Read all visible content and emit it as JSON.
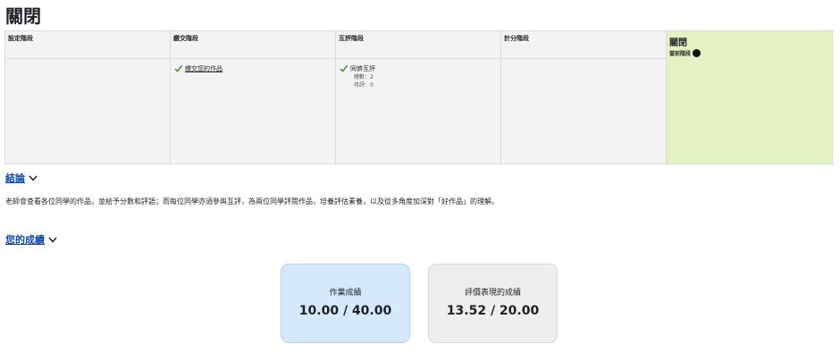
{
  "page": {
    "title": "關閉"
  },
  "phases": {
    "setup": {
      "label": "設定階段"
    },
    "submission": {
      "label": "繳交階段",
      "task_label": "繳交您的作品"
    },
    "assessment": {
      "label": "互評階段",
      "task_label": "同儕互評",
      "total_line": "總數：2",
      "pending_line": "待評：0"
    },
    "grading": {
      "label": "計分階段"
    },
    "closed": {
      "label": "關閉",
      "current_label": "當前階段"
    }
  },
  "conclusion": {
    "heading": "結論",
    "text": "老師會查看各位同學的作品，並給予分數和評語；而每位同學亦須參與互評，為兩位同學評閱作品，培養評估素養，以及從多角度加深對「好作品」的理解。"
  },
  "grades": {
    "heading": "您的成績",
    "submission_label": "作業成績",
    "submission_value": "10.00 / 40.00",
    "assessment_label": "評價表現的成績",
    "assessment_value": "13.52 / 20.00"
  },
  "colors": {
    "current_phase_bg": "#e4f2c3",
    "link": "#0f47ad",
    "check": "#3a8e1f",
    "submission_card_bg": "#d5e9fd",
    "assessment_card_bg": "#eeeeee"
  },
  "icons": {
    "check": "check-icon",
    "chevron": "chevron-down-icon",
    "current_marker": "current-phase-dot-icon"
  }
}
